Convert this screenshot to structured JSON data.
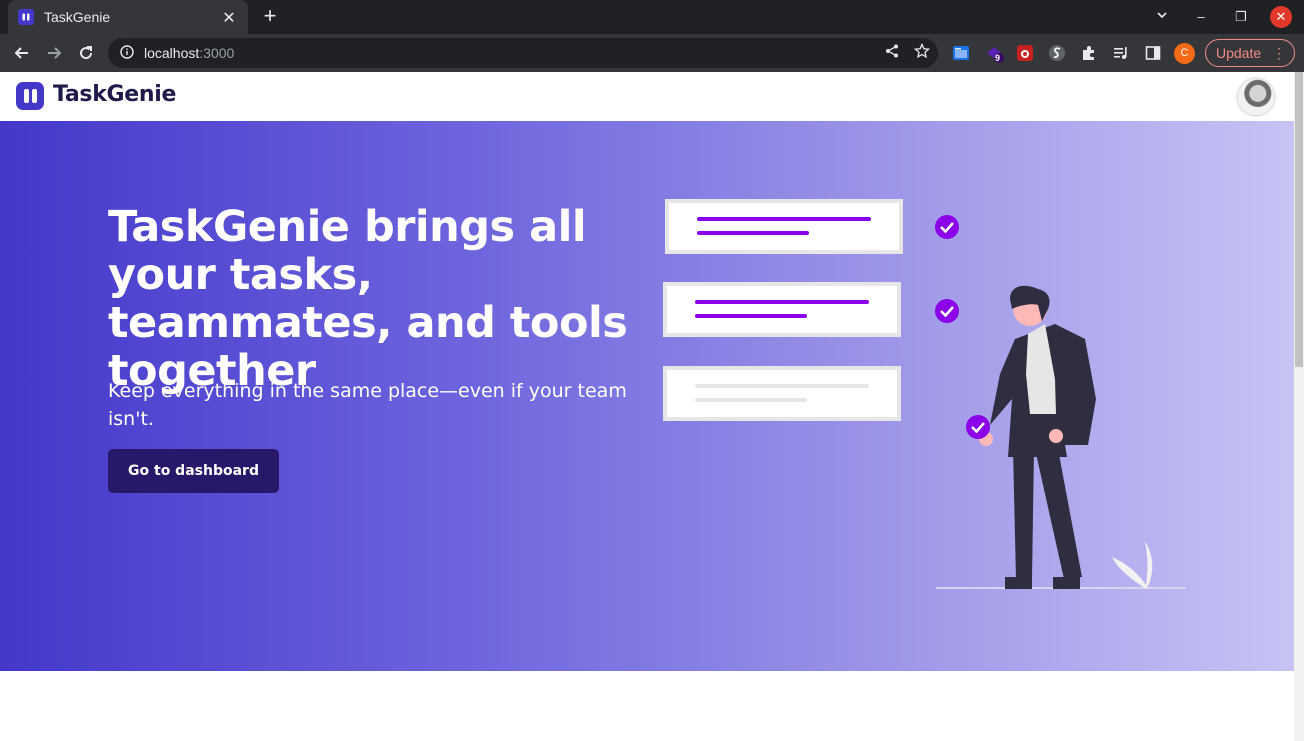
{
  "browser": {
    "tab_title": "TaskGenie",
    "tab_close": "✕",
    "new_tab": "+",
    "url_host": "localhost",
    "url_port": ":3000",
    "extension_badge": "9",
    "profile_initial": "C",
    "update_label": "Update",
    "window_controls": {
      "minimize": "–",
      "restore": "❐",
      "close": "✕",
      "tab_list": "⌄"
    },
    "accent_update": "#f28b82"
  },
  "app": {
    "brand": "TaskGenie",
    "brand_color": "#4338ca"
  },
  "hero": {
    "title": "TaskGenie brings all your tasks, teammates, and tools together",
    "subtitle": "Keep everything in the same place—even if your team isn't.",
    "cta_label": "Go to dashboard",
    "cta_color": "#28186a",
    "gradient_start": "#4338ca",
    "gradient_end": "#c7c3f4"
  },
  "illustration": {
    "check_color": "#8b00e8",
    "task_cards": [
      {
        "state": "checked"
      },
      {
        "state": "checked"
      },
      {
        "state": "unchecked"
      }
    ]
  }
}
